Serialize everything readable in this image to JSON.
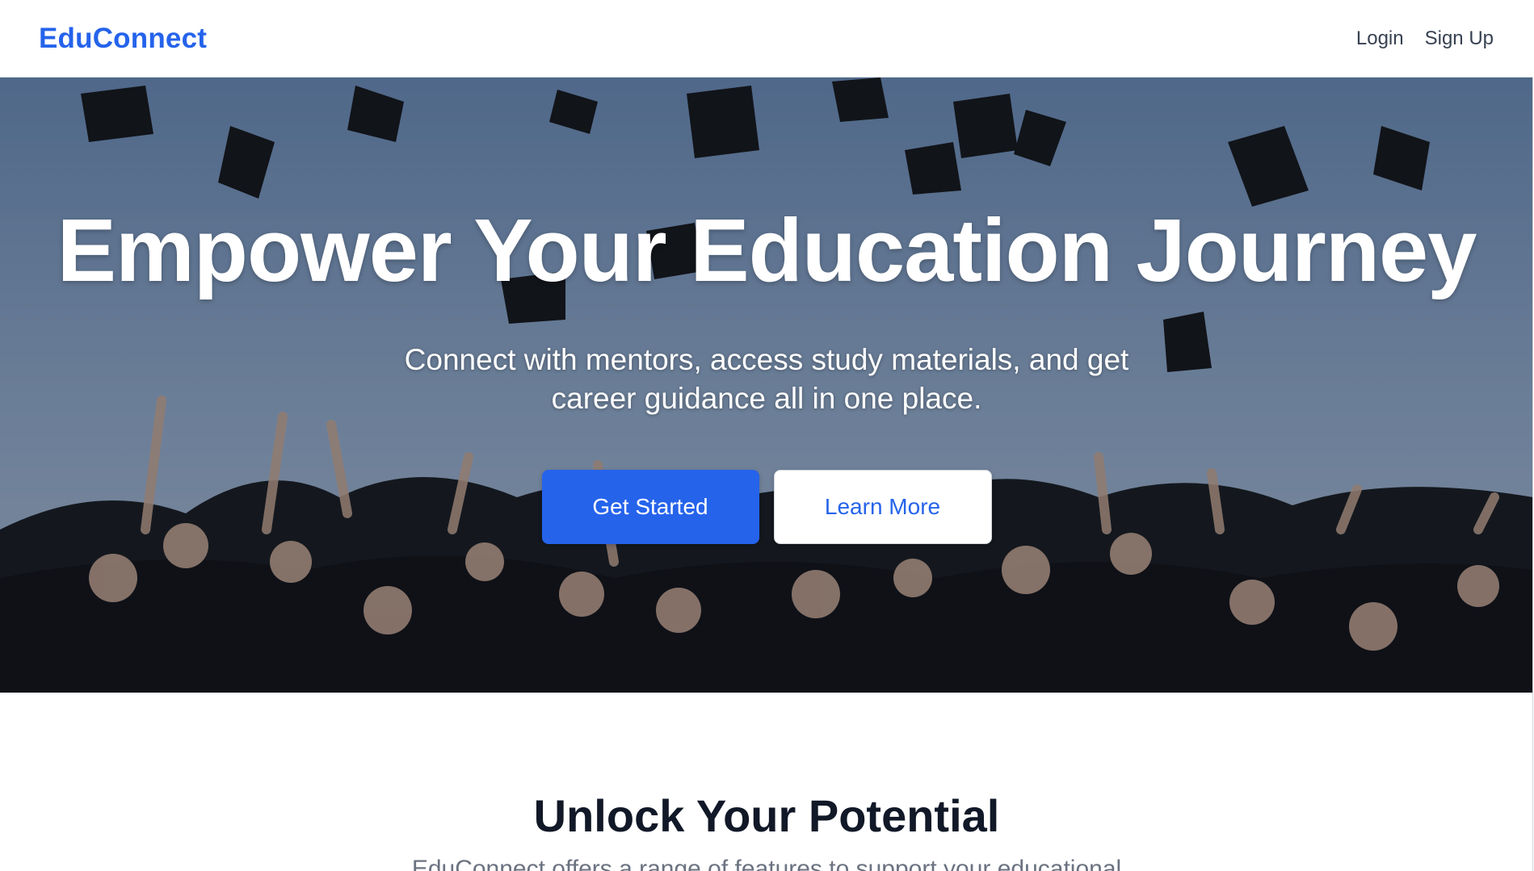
{
  "header": {
    "brand": "EduConnect",
    "nav": [
      {
        "label": "Login"
      },
      {
        "label": "Sign Up"
      }
    ]
  },
  "hero": {
    "title": "Empower Your Education Journey",
    "subtitle": "Connect with mentors, access study materials, and get career guidance all in one place.",
    "primary_button": "Get Started",
    "secondary_button": "Learn More"
  },
  "features": {
    "title": "Unlock Your Potential",
    "description": "EduConnect offers a range of features to support your educational"
  },
  "colors": {
    "brand": "#2563eb",
    "text_dark": "#111827",
    "text_muted": "#6b7280",
    "nav_text": "#374151"
  }
}
